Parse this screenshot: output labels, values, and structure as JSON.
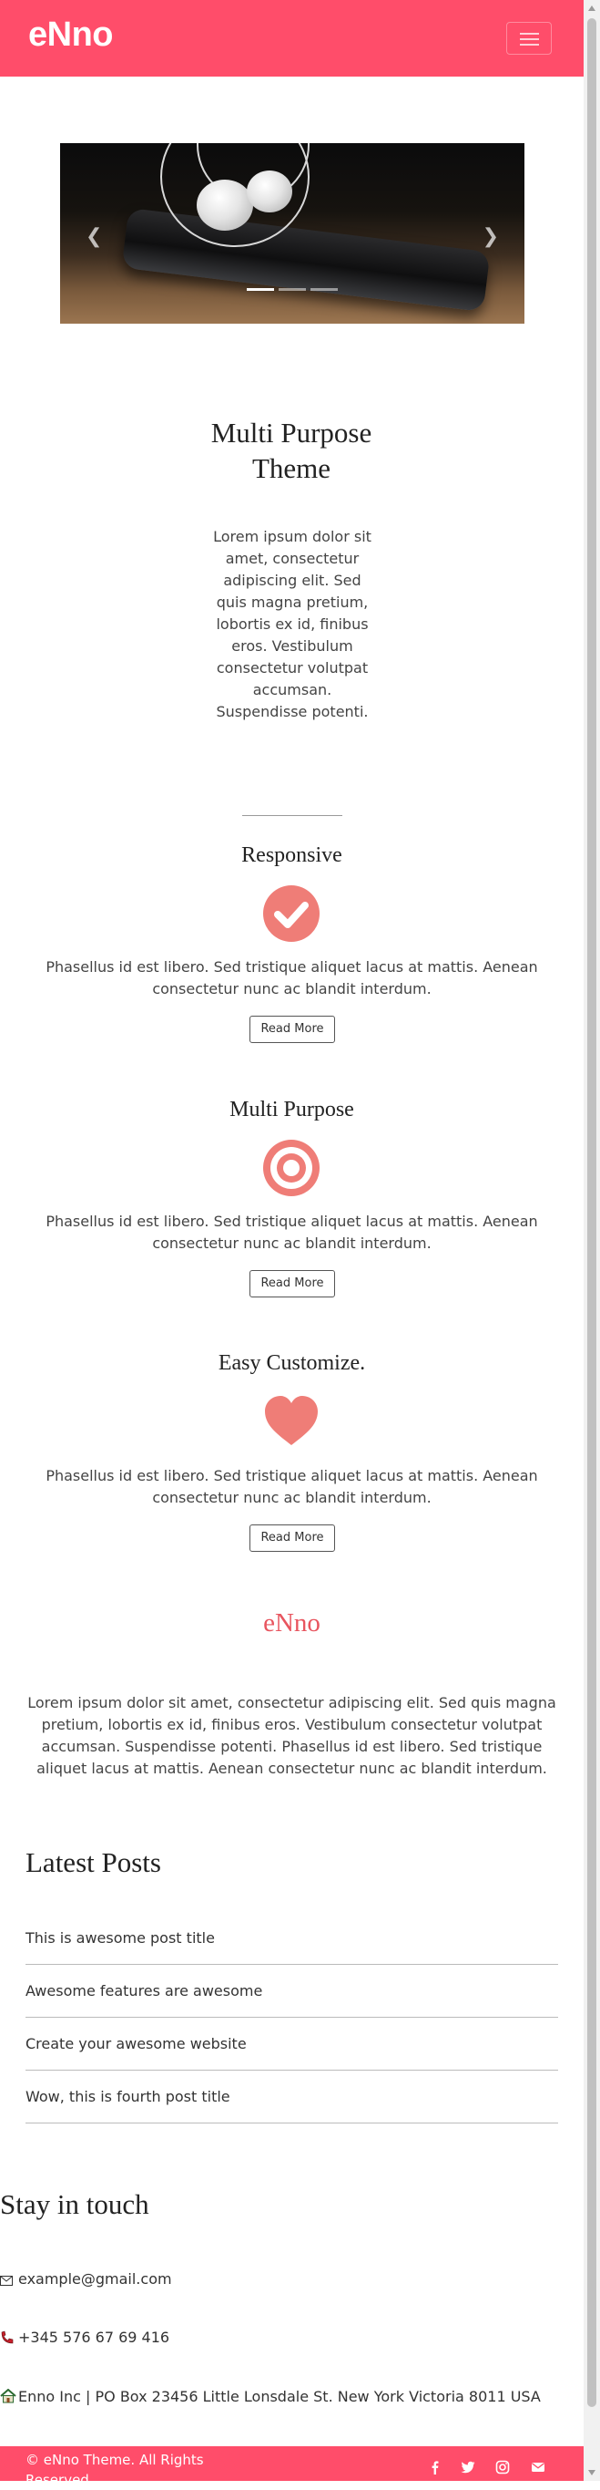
{
  "navbar": {
    "brand": "eNno",
    "background": "#ff4d6a"
  },
  "carousel": {
    "prev_icon": "chevron-left-icon",
    "next_icon": "chevron-right-icon",
    "slides": 3,
    "active_slide": 1
  },
  "intro": {
    "title": "Multi Purpose Theme",
    "text": "Lorem ipsum dolor sit amet, consectetur adipiscing elit. Sed quis magna pretium, lobortis ex id, finibus eros. Vestibulum consectetur volutpat accumsan. Suspendisse potenti."
  },
  "features": [
    {
      "title": "Responsive",
      "icon": "check-circle-icon",
      "text": "Phasellus id est libero. Sed tristique aliquet lacus at mattis. Aenean consectetur nunc ac blandit interdum.",
      "button": "Read More"
    },
    {
      "title": "Multi Purpose",
      "icon": "target-icon",
      "text": "Phasellus id est libero. Sed tristique aliquet lacus at mattis. Aenean consectetur nunc ac blandit interdum.",
      "button": "Read More"
    },
    {
      "title": "Easy Customize.",
      "icon": "heart-icon",
      "text": "Phasellus id est libero. Sed tristique aliquet lacus at mattis. Aenean consectetur nunc ac blandit interdum.",
      "button": "Read More"
    }
  ],
  "about": {
    "heading": "eNno",
    "text": "Lorem ipsum dolor sit amet, consectetur adipiscing elit. Sed quis magna pretium, lobortis ex id, finibus eros. Vestibulum consectetur volutpat accumsan. Suspendisse potenti. Phasellus id est libero. Sed tristique aliquet lacus at mattis. Aenean consectetur nunc ac blandit interdum."
  },
  "posts": {
    "heading": "Latest Posts",
    "items": [
      "This is awesome post title",
      "Awesome features are awesome",
      "Create your awesome website",
      "Wow, this is fourth post title"
    ]
  },
  "contact": {
    "heading": "Stay in touch",
    "email": "example@gmail.com",
    "phone": "+345 576 67 69 416",
    "address": "Enno Inc | PO Box 23456 Little Lonsdale St. New York Victoria 8011 USA"
  },
  "footer": {
    "copyright": "© eNno Theme. All Rights Reserved",
    "social": [
      "facebook-icon",
      "twitter-icon",
      "instagram-icon",
      "envelope-icon"
    ]
  },
  "colors": {
    "accent": "#ff4d6a",
    "icon": "#ef7d77",
    "heading_accent": "#e8555f"
  }
}
